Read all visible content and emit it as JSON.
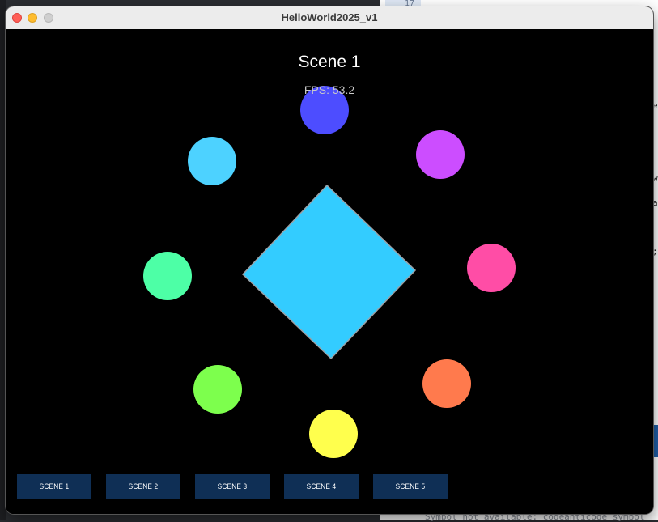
{
  "window": {
    "title": "HelloWorld2025_v1"
  },
  "scene": {
    "title": "Scene 1",
    "fps": "FPS: 53.2",
    "diamond_color": "#33ccff",
    "circles": [
      {
        "name": "circle-blue",
        "color": "#4d4dff"
      },
      {
        "name": "circle-purple",
        "color": "#cc4dff"
      },
      {
        "name": "circle-pink",
        "color": "#ff4da6"
      },
      {
        "name": "circle-orange",
        "color": "#ff7a4d"
      },
      {
        "name": "circle-yellow",
        "color": "#ffff4d"
      },
      {
        "name": "circle-lime",
        "color": "#7dff4d"
      },
      {
        "name": "circle-green",
        "color": "#4dffa6"
      },
      {
        "name": "circle-cyan",
        "color": "#4dd2ff"
      }
    ]
  },
  "buttons": [
    {
      "label": "SCENE 1"
    },
    {
      "label": "SCENE 2"
    },
    {
      "label": "SCENE 3"
    },
    {
      "label": "SCENE 4"
    },
    {
      "label": "SCENE 5"
    }
  ],
  "background": {
    "gutter_number": "17",
    "bottom_text": "Symbol not available: codeanticode symbol"
  }
}
